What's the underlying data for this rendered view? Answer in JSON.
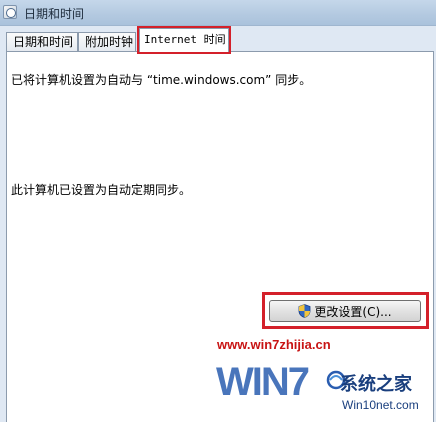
{
  "window": {
    "title": "日期和时间"
  },
  "tabs": [
    {
      "label": "日期和时间",
      "active": false
    },
    {
      "label": "附加时钟",
      "active": false
    },
    {
      "label": "Internet 时间",
      "active": true
    }
  ],
  "content": {
    "sync_message": "已将计算机设置为自动与 “time.windows.com” 同步。",
    "schedule_message": "此计算机已设置为自动定期同步。"
  },
  "change_settings_button": {
    "label": "更改设置(C)..."
  },
  "icons": {
    "window_icon": "clock-icon",
    "button_icon": "uac-shield-icon"
  },
  "colors": {
    "highlight": "#d4202a",
    "watermark_red": "#c81414",
    "watermark_blue": "#2a5db0"
  },
  "watermark": {
    "url": "www.win7zhijia.cn",
    "logo_text": "WIN7",
    "site_name": "系统之家",
    "site_url": "Win10net.com"
  }
}
